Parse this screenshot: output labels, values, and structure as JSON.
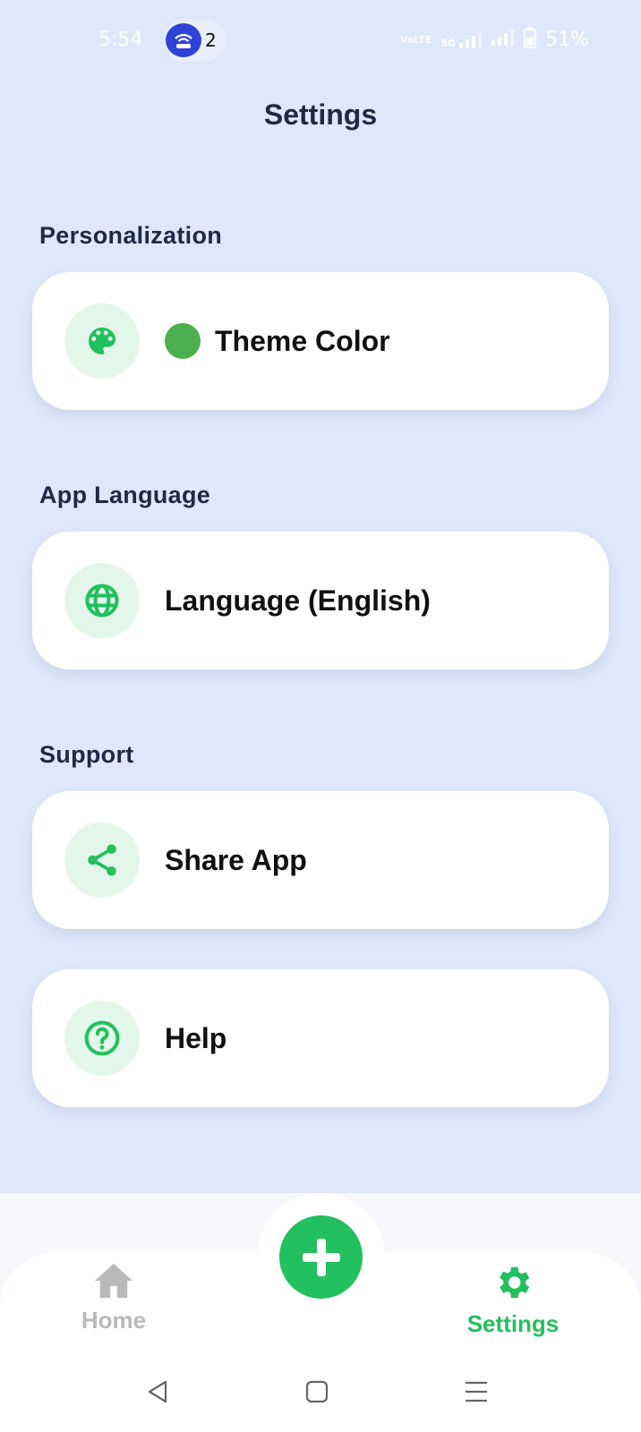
{
  "status_bar": {
    "time": "5:54",
    "notification_count": "2",
    "network_labels": [
      "VoLTE",
      "5G"
    ],
    "battery": "51%"
  },
  "header": {
    "title": "Settings"
  },
  "sections": {
    "personalization": {
      "label": "Personalization",
      "theme_color": {
        "label": "Theme Color",
        "icon": "palette-icon",
        "color": "#4caf50"
      }
    },
    "app_language": {
      "label": "App Language",
      "language": {
        "label": "Language (English)",
        "icon": "globe-icon"
      }
    },
    "support": {
      "label": "Support",
      "share": {
        "label": "Share App",
        "icon": "share-icon"
      },
      "help": {
        "label": "Help",
        "icon": "help-circle-icon"
      }
    }
  },
  "bottom_nav": {
    "home_label": "Home",
    "settings_label": "Settings",
    "fab_icon": "plus-icon",
    "active": "Settings"
  },
  "colors": {
    "accent": "#22c05e",
    "background": "#dfe7fa",
    "inactive": "#b9b9b9"
  }
}
